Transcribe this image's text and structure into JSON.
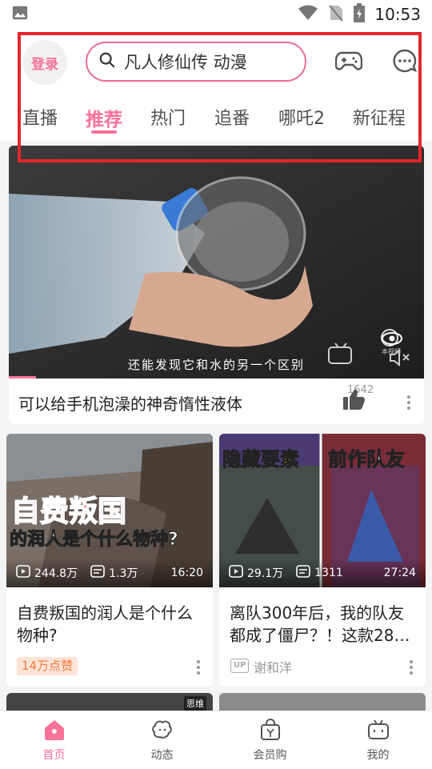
{
  "status_bar": {
    "time": "10:53",
    "icons": [
      "image-icon",
      "wifi-icon",
      "no-sim-icon",
      "battery-icon"
    ]
  },
  "header": {
    "login_label": "登录",
    "search": {
      "placeholder": "凡人修仙传 动漫"
    },
    "icons": [
      "game-controller-icon",
      "message-icon"
    ],
    "tabs": [
      {
        "label": "直播"
      },
      {
        "label": "推荐",
        "active": true
      },
      {
        "label": "热门"
      },
      {
        "label": "追番"
      },
      {
        "label": "哪吒2"
      },
      {
        "label": "新征程"
      }
    ]
  },
  "feed": {
    "featured": {
      "title": "可以给手机泡澡的神奇惰性液体",
      "subtitle_overlay": "还能发现它和水的另一个区别",
      "like_count": "1642",
      "overlay_icons": [
        "danmaku-icon",
        "eye-icon",
        "mute-icon"
      ],
      "overlay_watermark": "本视频"
    },
    "cards": [
      {
        "thumb_text_line1": "自费叛国",
        "thumb_text_line2": "的润人是个什么物种?",
        "views": "244.8万",
        "danmaku": "1.3万",
        "duration": "16:20",
        "title": "自费叛国的润人是个什么物种?",
        "badge": "14万点赞"
      },
      {
        "thumb_text_left": "隐藏要素",
        "thumb_text_right": "前作队友",
        "views": "29.1万",
        "danmaku": "1311",
        "duration": "27:24",
        "title": "离队300年后，我的队友都成了僵尸？！这款28…",
        "up_tag": "UP",
        "uploader": "谢和洋"
      }
    ],
    "peek_left_tag": "思维"
  },
  "bottom_nav": [
    {
      "label": "首页",
      "icon": "home-icon",
      "active": true
    },
    {
      "label": "动态",
      "icon": "dynamic-icon"
    },
    {
      "label": "会员购",
      "icon": "shopping-bag-icon"
    },
    {
      "label": "我的",
      "icon": "profile-tv-icon"
    }
  ],
  "colors": {
    "accent": "#fb7299",
    "highlight_box": "#e3262c",
    "badge_bg": "#fde4d7",
    "badge_text": "#f27a3d"
  }
}
